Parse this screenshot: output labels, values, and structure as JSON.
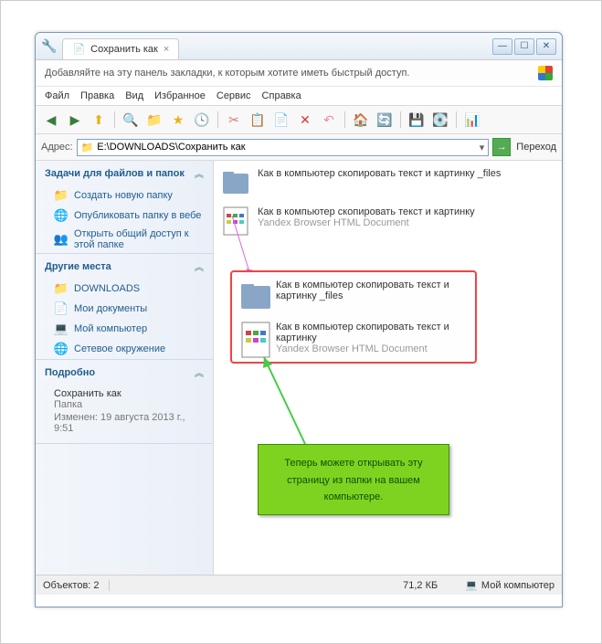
{
  "titlebar": {
    "tab_label": "Сохранить как"
  },
  "bookmark_prompt": "Добавляйте на эту панель закладки, к которым хотите иметь быстрый доступ.",
  "menubar": [
    "Файл",
    "Правка",
    "Вид",
    "Избранное",
    "Сервис",
    "Справка"
  ],
  "addressbar": {
    "label": "Адрес:",
    "value": "E:\\DOWNLOADS\\Сохранить как",
    "go_label": "Переход"
  },
  "sidebar": {
    "tasks": {
      "header": "Задачи для файлов и папок",
      "items": [
        {
          "label": "Создать новую папку",
          "icon": "folder-new-icon"
        },
        {
          "label": "Опубликовать папку в вебе",
          "icon": "publish-icon"
        },
        {
          "label": "Открыть общий доступ к этой папке",
          "icon": "share-icon"
        }
      ]
    },
    "places": {
      "header": "Другие места",
      "items": [
        {
          "label": "DOWNLOADS",
          "icon": "folder-icon"
        },
        {
          "label": "Мои документы",
          "icon": "documents-icon"
        },
        {
          "label": "Мой компьютер",
          "icon": "computer-icon"
        },
        {
          "label": "Сетевое окружение",
          "icon": "network-icon"
        }
      ]
    },
    "details": {
      "header": "Подробно",
      "name": "Сохранить как",
      "type": "Папка",
      "modified": "Изменен: 19 августа 2013 г., 9:51"
    }
  },
  "files": [
    {
      "name": "Как в компьютер скопировать текст и картинку _files",
      "subtype": null,
      "icon": "folder"
    },
    {
      "name": "Как в компьютер скопировать текст и картинку",
      "subtype": "Yandex Browser HTML Document",
      "icon": "html"
    }
  ],
  "callout_files": [
    {
      "name": "Как в компьютер скопировать текст и картинку _files",
      "subtype": null,
      "icon": "folder"
    },
    {
      "name": "Как в компьютер скопировать текст и картинку",
      "subtype": "Yandex Browser HTML Document",
      "icon": "html"
    }
  ],
  "annotation": "Теперь можете открывать эту страницу из папки на вашем компьютере.",
  "statusbar": {
    "objects": "Объектов: 2",
    "size": "71,2 КБ",
    "location": "Мой компьютер"
  }
}
